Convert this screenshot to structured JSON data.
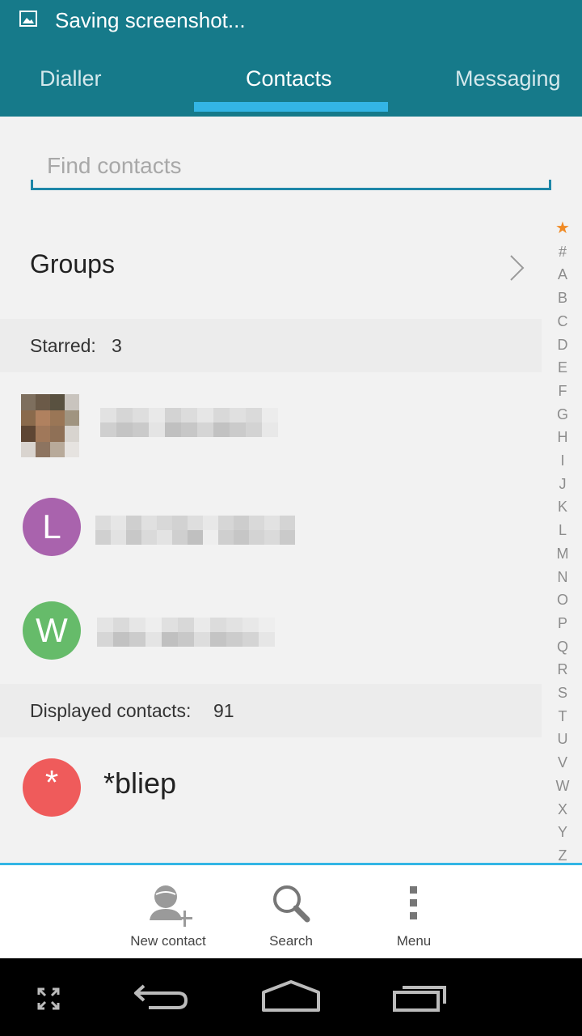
{
  "status_bar": {
    "notification_icon": "image-icon",
    "text": "Saving screenshot..."
  },
  "tabs": [
    {
      "label": "Dialler",
      "active": false
    },
    {
      "label": "Contacts",
      "active": true
    },
    {
      "label": "Messaging",
      "active": false
    }
  ],
  "search": {
    "placeholder": "Find contacts",
    "value": ""
  },
  "groups": {
    "label": "Groups",
    "icon": "chevron-right-icon"
  },
  "starred": {
    "label": "Starred:",
    "count": "3",
    "contacts": [
      {
        "avatar": "photo",
        "name_blurred": true
      },
      {
        "avatar_letter": "L",
        "color": "#a963ad",
        "name_blurred": true
      },
      {
        "avatar_letter": "W",
        "color": "#66bb6a",
        "name_blurred": true
      }
    ]
  },
  "displayed": {
    "label": "Displayed contacts:",
    "count": "91",
    "contacts": [
      {
        "avatar_letter": "*",
        "color": "#ef5b5b",
        "name": "*bliep"
      }
    ]
  },
  "index_letters": [
    "★",
    "#",
    "A",
    "B",
    "C",
    "D",
    "E",
    "F",
    "G",
    "H",
    "I",
    "J",
    "K",
    "L",
    "M",
    "N",
    "O",
    "P",
    "Q",
    "R",
    "S",
    "T",
    "U",
    "V",
    "W",
    "X",
    "Y",
    "Z"
  ],
  "actions": [
    {
      "label": "New contact",
      "icon": "add-contact-icon"
    },
    {
      "label": "Search",
      "icon": "search-icon"
    },
    {
      "label": "Menu",
      "icon": "overflow-menu-icon"
    }
  ],
  "nav_bar": {
    "buttons": [
      "expand-icon",
      "back-icon",
      "home-icon",
      "recents-icon"
    ]
  },
  "colors": {
    "header": "#167a8a",
    "accent": "#33b5e5",
    "index_star": "#f08a24"
  }
}
